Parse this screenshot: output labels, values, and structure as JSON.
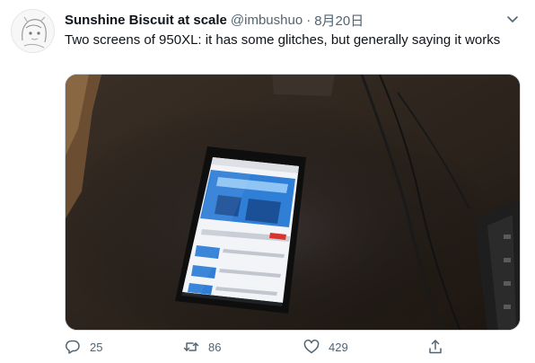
{
  "tweet": {
    "author_name": "Sunshine Biscuit at scale",
    "handle": "@imbushuo",
    "separator": "·",
    "date": "8月20日",
    "text": "Two screens of 950XL: it has some glitches, but generally saying it works"
  },
  "actions": {
    "replies": "25",
    "retweets": "86",
    "likes": "429"
  },
  "icons": {
    "reply": "reply-icon",
    "retweet": "retweet-icon",
    "like": "like-icon",
    "share": "share-icon",
    "more": "chevron-down-icon"
  },
  "colors": {
    "text": "#0f1419",
    "secondary": "#536471",
    "media_bg": "#2d241d"
  }
}
